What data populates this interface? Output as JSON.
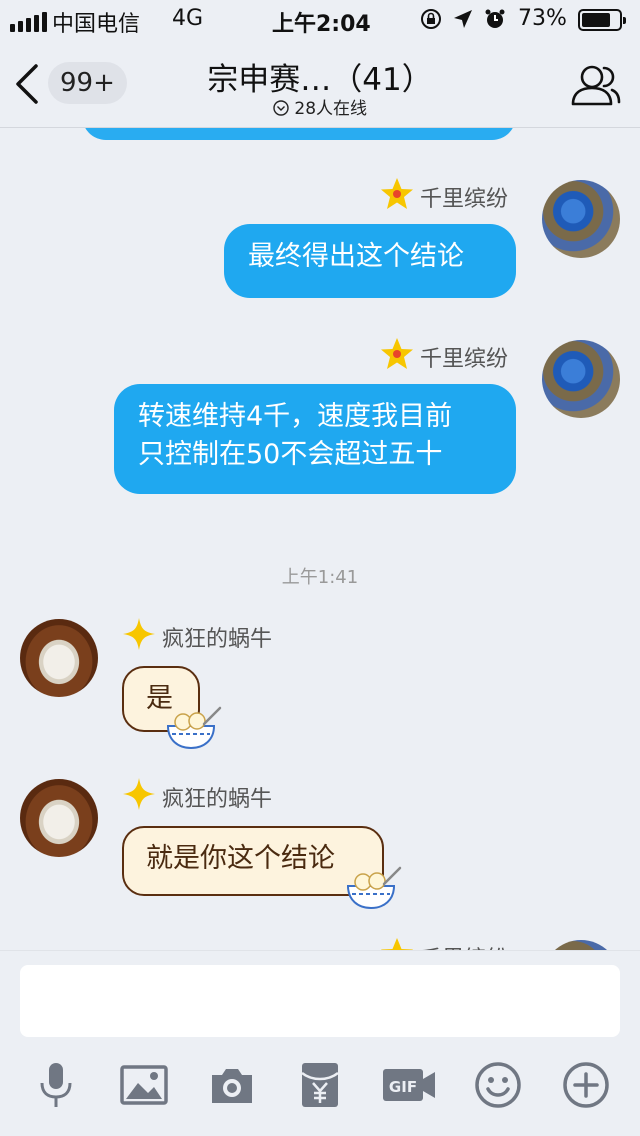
{
  "status_bar": {
    "carrier": "中国电信",
    "network": "4G",
    "time": "上午2:04",
    "battery_percent": "73%",
    "battery_level": 0.73
  },
  "header": {
    "back_badge": "99+",
    "title": "宗申赛…（41）",
    "online": "28人在线"
  },
  "messages": [
    {
      "sender": "千里缤纷",
      "side": "right",
      "text": "最终得出这个结论"
    },
    {
      "sender": "千里缤纷",
      "side": "right",
      "text_lines": [
        "转速维持4千，速度我目前",
        "只控制在50不会超过五十"
      ]
    },
    {
      "time_separator": "上午1:41"
    },
    {
      "sender": "疯狂的蜗牛",
      "side": "left",
      "text": "是"
    },
    {
      "sender": "疯狂的蜗牛",
      "side": "left",
      "text": "就是你这个结论"
    },
    {
      "sender": "千里缤纷",
      "side": "right",
      "partial": true
    }
  ],
  "toolbar": {
    "icons": [
      "microphone-icon",
      "image-icon",
      "camera-icon",
      "red-packet-icon",
      "gif-icon",
      "emoji-icon",
      "plus-icon"
    ]
  },
  "colors": {
    "bubble_blue": "#1fa8f0",
    "bubble_left_bg": "#fdf3de",
    "bubble_left_border": "#5a2e10",
    "background": "#eceff4",
    "star": "#f7c600"
  }
}
